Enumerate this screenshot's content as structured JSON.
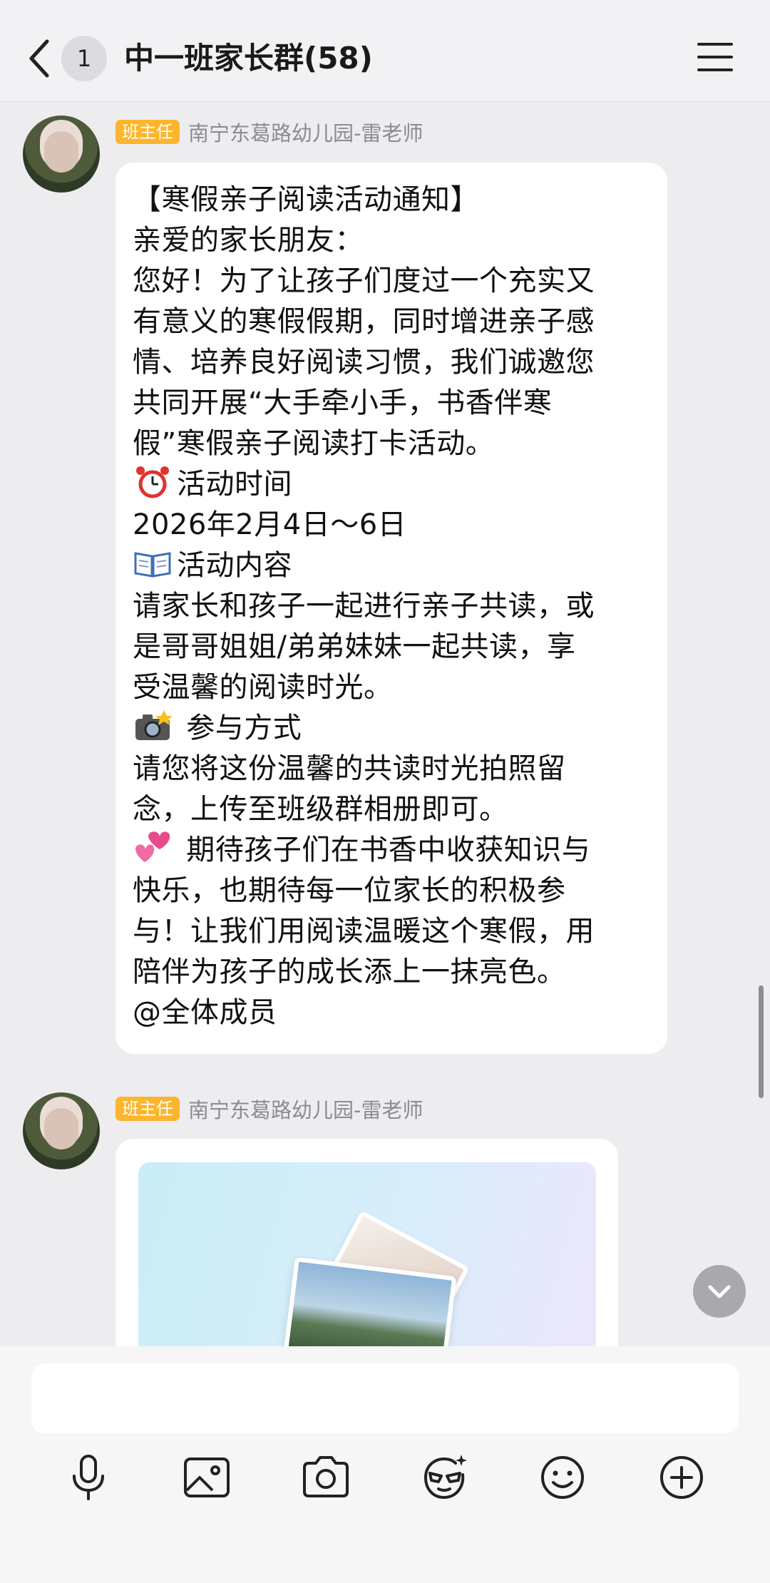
{
  "header": {
    "back_icon": "chevron-left-icon",
    "unread_count": "1",
    "title": "中一班家长群(58)",
    "menu_icon": "hamburger-menu-icon"
  },
  "messages": [
    {
      "role_badge": "班主任",
      "sender": "南宁东葛路幼儿园-雷老师",
      "lines": [
        "【寒假亲子阅读活动通知】",
        "亲爱的家长朋友：",
        "您好！为了让孩子们度过一个充实又",
        "有意义的寒假假期，同时增进亲子感",
        "情、培养良好阅读习惯，我们诚邀您",
        "共同开展“大手牵小手，书香伴寒",
        "假”寒假亲子阅读打卡活动。",
        "活动时间",
        "2026年2月4日～6日",
        "活动内容",
        "请家长和孩子一起进行亲子共读，或",
        "是哥哥姐姐/弟弟妹妹一起共读，享",
        "受温馨的阅读时光。",
        " 参与方式",
        "请您将这份温馨的共读时光拍照留",
        "念，上传至班级群相册即可。",
        " 期待孩子们在书香中收获知识与",
        "快乐，也期待每一位家长的积极参",
        "与！让我们用阅读温暖这个寒假，用",
        "陪伴为孩子的成长添上一抹亮色。",
        "@全体成员"
      ],
      "line_icons": {
        "7": "alarm-clock-icon",
        "9": "open-book-icon",
        "13": "camera-flash-icon",
        "16": "two-hearts-icon"
      }
    },
    {
      "role_badge": "班主任",
      "sender": "南宁东葛路幼儿园-雷老师",
      "attachment_icon": "photo-album-icon"
    }
  ],
  "input": {
    "placeholder": ""
  },
  "toolbar": [
    "microphone-icon",
    "image-icon",
    "camera-icon",
    "sticker-face-icon",
    "smiley-icon",
    "plus-circle-icon"
  ],
  "colors": {
    "role_badge": "#fcb52c",
    "background": "#ededf0",
    "bubble": "#ffffff"
  }
}
